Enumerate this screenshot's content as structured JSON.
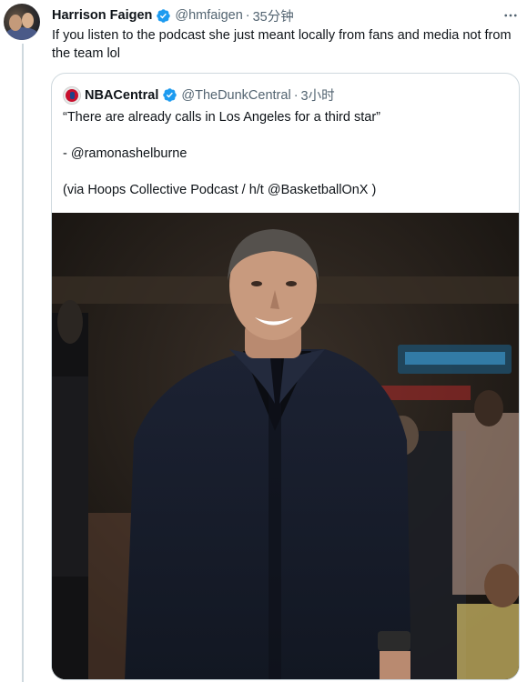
{
  "tweet": {
    "author_name": "Harrison Faigen",
    "author_handle": "@hmfaigen",
    "separator": "·",
    "time": "35分钟",
    "text": "If you listen to the podcast she just meant locally from fans and media not from the team lol"
  },
  "quoted_tweet": {
    "author_name": "NBACentral",
    "author_handle": "@TheDunkCentral",
    "separator": "·",
    "time": "3小时",
    "lines": [
      "“There are already calls in Los Angeles for a third star”",
      "- @ramonashelburne",
      "(via Hoops Collective Podcast / h/t @BasketballOnX )"
    ]
  },
  "icons": {
    "verified": "verified-badge-icon",
    "more": "more-options-icon"
  },
  "colors": {
    "verified_blue": "#1d9bf0",
    "muted_text": "#536471",
    "border": "#cfd9de"
  }
}
